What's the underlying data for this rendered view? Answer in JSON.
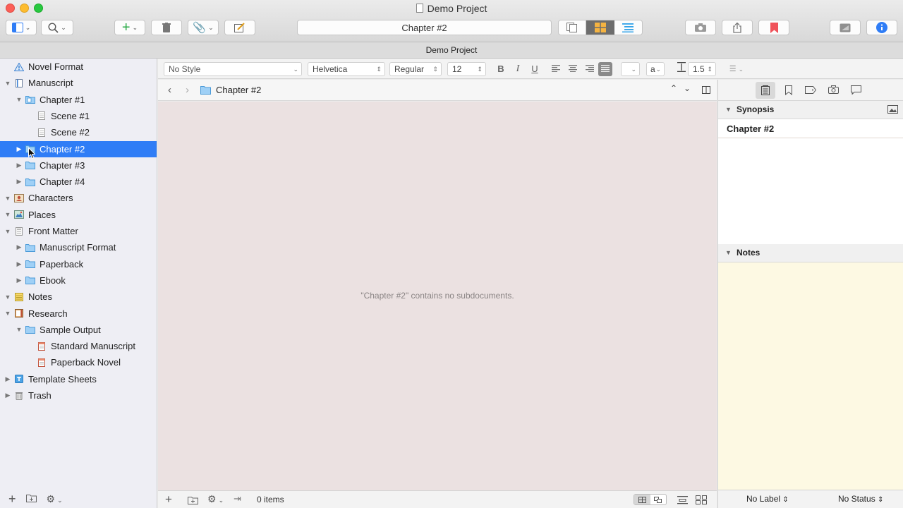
{
  "window": {
    "title": "Demo Project",
    "subtitle": "Demo Project"
  },
  "toolbar": {
    "center_title": "Chapter #2"
  },
  "binder": {
    "items": [
      {
        "label": "Novel Format",
        "depth": 0,
        "disclosure": "none",
        "icon": "warning-triangle-icon",
        "selected": false
      },
      {
        "label": "Manuscript",
        "depth": 0,
        "disclosure": "open",
        "icon": "manuscript-icon",
        "selected": false
      },
      {
        "label": "Chapter #1",
        "depth": 1,
        "disclosure": "open",
        "icon": "folder-docs-icon",
        "selected": false
      },
      {
        "label": "Scene #1",
        "depth": 2,
        "disclosure": "none",
        "icon": "document-icon",
        "selected": false
      },
      {
        "label": "Scene #2",
        "depth": 2,
        "disclosure": "none",
        "icon": "document-icon",
        "selected": false
      },
      {
        "label": "Chapter #2",
        "depth": 1,
        "disclosure": "closed",
        "icon": "folder-icon",
        "selected": true
      },
      {
        "label": "Chapter #3",
        "depth": 1,
        "disclosure": "closed",
        "icon": "folder-icon",
        "selected": false
      },
      {
        "label": "Chapter #4",
        "depth": 1,
        "disclosure": "closed",
        "icon": "folder-icon",
        "selected": false
      },
      {
        "label": "Characters",
        "depth": 0,
        "disclosure": "open",
        "icon": "characters-icon",
        "selected": false
      },
      {
        "label": "Places",
        "depth": 0,
        "disclosure": "open",
        "icon": "places-icon",
        "selected": false
      },
      {
        "label": "Front Matter",
        "depth": 0,
        "disclosure": "open",
        "icon": "front-matter-icon",
        "selected": false
      },
      {
        "label": "Manuscript Format",
        "depth": 1,
        "disclosure": "closed",
        "icon": "folder-icon",
        "selected": false
      },
      {
        "label": "Paperback",
        "depth": 1,
        "disclosure": "closed",
        "icon": "folder-icon",
        "selected": false
      },
      {
        "label": "Ebook",
        "depth": 1,
        "disclosure": "closed",
        "icon": "folder-icon",
        "selected": false
      },
      {
        "label": "Notes",
        "depth": 0,
        "disclosure": "open",
        "icon": "notes-icon",
        "selected": false
      },
      {
        "label": "Research",
        "depth": 0,
        "disclosure": "open",
        "icon": "research-icon",
        "selected": false
      },
      {
        "label": "Sample Output",
        "depth": 1,
        "disclosure": "open",
        "icon": "folder-icon",
        "selected": false
      },
      {
        "label": "Standard Manuscript",
        "depth": 2,
        "disclosure": "none",
        "icon": "pdf-document-icon",
        "selected": false
      },
      {
        "label": "Paperback Novel",
        "depth": 2,
        "disclosure": "none",
        "icon": "pdf-document-icon",
        "selected": false
      },
      {
        "label": "Template Sheets",
        "depth": 0,
        "disclosure": "closed",
        "icon": "template-sheets-icon",
        "selected": false
      },
      {
        "label": "Trash",
        "depth": 0,
        "disclosure": "closed",
        "icon": "trash-icon",
        "selected": false
      }
    ]
  },
  "format_bar": {
    "style": "No Style",
    "font": "Helvetica",
    "weight": "Regular",
    "size": "12",
    "bold": "B",
    "italic": "I",
    "underline": "U",
    "highlight": "a",
    "line_spacing": "1.5"
  },
  "editor": {
    "header_title": "Chapter #2",
    "empty_message": "\"Chapter #2\" contains no subdocuments.",
    "item_count": "0 items"
  },
  "inspector": {
    "synopsis_label": "Synopsis",
    "synopsis_title": "Chapter #2",
    "notes_label": "Notes",
    "label_value": "No Label",
    "status_value": "No Status"
  },
  "colors": {
    "accent": "#2f7df6",
    "editor_bg": "#ebe1e1",
    "notes_bg": "#fdf9e3",
    "bookmark": "#f0525a"
  }
}
